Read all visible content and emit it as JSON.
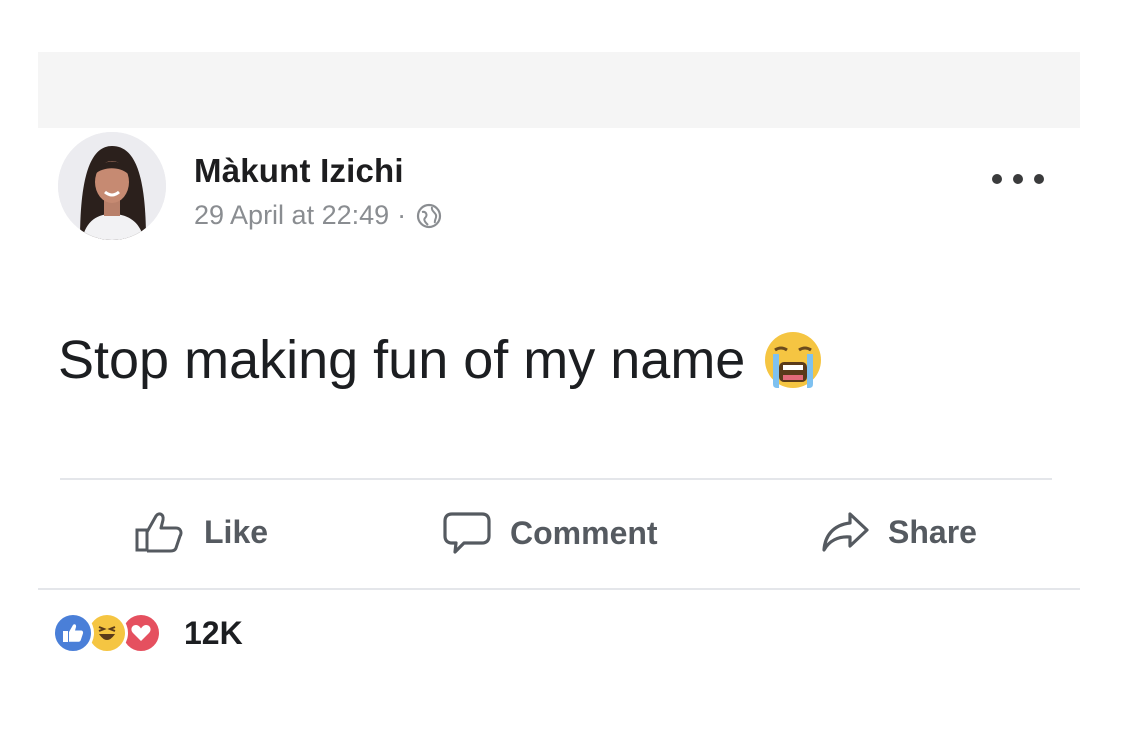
{
  "post": {
    "author_name": "Màkunt Izichi",
    "timestamp": "29 April at 22:49",
    "separator": "·",
    "privacy_icon": "globe-icon",
    "more_icon": "more-options-icon",
    "text": "Stop making fun of my name",
    "text_emoji": "loudly-crying-face-emoji"
  },
  "actions": {
    "like_label": "Like",
    "comment_label": "Comment",
    "share_label": "Share"
  },
  "reactions": {
    "icons": [
      "like-reaction-icon",
      "haha-reaction-icon",
      "love-reaction-icon"
    ],
    "count": "12K"
  },
  "colors": {
    "like_blue": "#4a7fd8",
    "love_red": "#e5505f",
    "haha_yellow": "#f5c542",
    "muted_text": "#8a8d91"
  }
}
